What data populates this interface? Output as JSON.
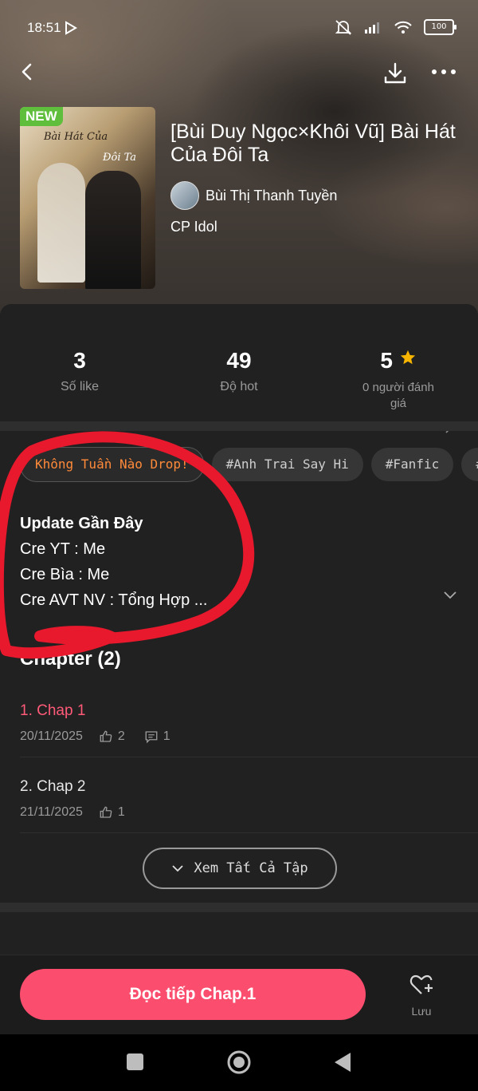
{
  "status_bar": {
    "time": "18:51",
    "battery": "100"
  },
  "book": {
    "badge": "NEW",
    "cover_text_1": "Bài Hát Của",
    "cover_text_2": "Đôi Ta",
    "title": "[Bùi Duy Ngọc×Khôi Vũ] Bài Hát Của Đôi Ta",
    "author": "Bùi Thị Thanh Tuyền",
    "category": "CP Idol"
  },
  "stats": {
    "likes_value": "3",
    "likes_label": "Số like",
    "hot_value": "49",
    "hot_label": "Độ hot",
    "rating_value": "5",
    "rating_label": "0 người đánh giá"
  },
  "tags": [
    "Không Tuần Nào Drop!",
    "#Anh Trai Say Hi",
    "#Fanfic",
    "#Ngọc"
  ],
  "description": {
    "heading": "Update Gần Đây",
    "line1": "Cre YT : Me",
    "line2": "Cre Bìa : Me",
    "line3": "Cre AVT NV : Tổng Hợp ..."
  },
  "chapters": {
    "header": "Chapter (2)",
    "items": [
      {
        "title": "1. Chap 1",
        "date": "20/11/2025",
        "likes": "2",
        "comments": "1",
        "color": "#ff5a78"
      },
      {
        "title": "2. Chap 2",
        "date": "21/11/2025",
        "likes": "1"
      }
    ],
    "see_all": "Xem Tất Cả Tập"
  },
  "bottom": {
    "read_button": "Đọc tiếp Chap.1",
    "save_label": "Lưu"
  },
  "colors": {
    "accent": "#fb4d6e",
    "star": "#f7b500",
    "annotation": "#e8182d"
  }
}
